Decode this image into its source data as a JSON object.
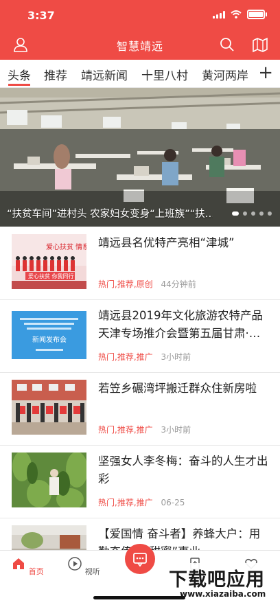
{
  "status_bar": {
    "time": "3:37"
  },
  "app_bar": {
    "title": "智慧靖远"
  },
  "tabs": [
    "头条",
    "推荐",
    "靖远新闻",
    "十里八村",
    "黄河两岸"
  ],
  "hero": {
    "caption": "“扶贫车间”进村头 农家妇女变身“上班族”“扶…"
  },
  "articles": [
    {
      "title": "靖远县名优特产亮相“津城”",
      "tags": "热门,推荐,原创",
      "time": "44分钟前"
    },
    {
      "title": "靖远县2019年文化旅游农特产品天津专场推介会暨第五届甘肃·…",
      "tags": "热门,推荐,推广",
      "time": "3小时前"
    },
    {
      "title": " 若笠乡碾湾坪搬迁群众住新房啦",
      "tags": "热门,推荐,推广",
      "time": "3小时前"
    },
    {
      "title": "坚强女人李冬梅：奋斗的人生才出彩",
      "tags": "热门,推荐,推广",
      "time": "06-25"
    },
    {
      "title": "【爱国情 奋斗者】养蜂大户：用勤奋传承“甜蜜”事业",
      "tags": "",
      "time": ""
    }
  ],
  "thumb_texts": {
    "a1_banner": "爱心扶贫 情系同行",
    "a1_strip": "爱心扶贫 你我同行",
    "a2_heading": "新闻发布会"
  },
  "bottom_nav": {
    "home": "首页",
    "listen": "视听"
  },
  "watermark": {
    "line1": "下载吧应用",
    "line2": "www.xiazaiba.com"
  },
  "colors": {
    "brand": "#ef4b45"
  }
}
